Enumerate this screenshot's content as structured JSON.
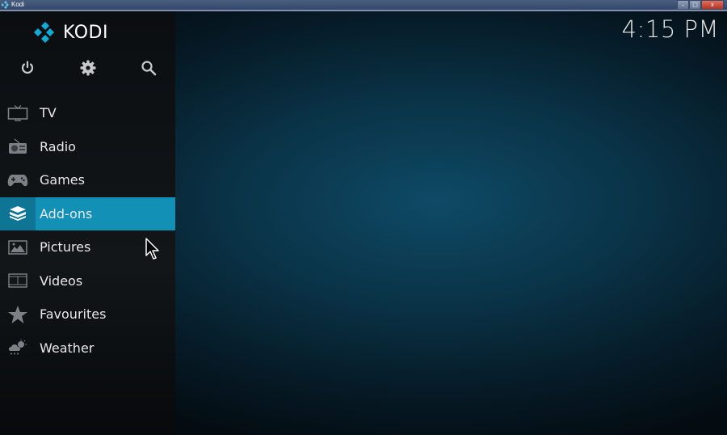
{
  "window": {
    "title": "Kodi",
    "minimize_label": "–",
    "restore_label": "□",
    "close_label": "x"
  },
  "logo": {
    "text": "KODI"
  },
  "clock": "4:15 PM",
  "top_icons": [
    {
      "name": "power-icon"
    },
    {
      "name": "settings-icon"
    },
    {
      "name": "search-icon"
    }
  ],
  "menu": [
    {
      "label": "TV",
      "icon": "tv-icon",
      "active": false
    },
    {
      "label": "Radio",
      "icon": "radio-icon",
      "active": false
    },
    {
      "label": "Games",
      "icon": "gamepad-icon",
      "active": false
    },
    {
      "label": "Add-ons",
      "icon": "addons-box-icon",
      "active": true
    },
    {
      "label": "Pictures",
      "icon": "pictures-icon",
      "active": false
    },
    {
      "label": "Videos",
      "icon": "film-icon",
      "active": false
    },
    {
      "label": "Favourites",
      "icon": "star-icon",
      "active": false
    },
    {
      "label": "Weather",
      "icon": "weather-icon",
      "active": false
    }
  ],
  "colors": {
    "accent": "#1390b5",
    "accent_dark": "#0f7594",
    "logo_blue": "#17a9d6",
    "icon_gray": "#7d8186"
  }
}
